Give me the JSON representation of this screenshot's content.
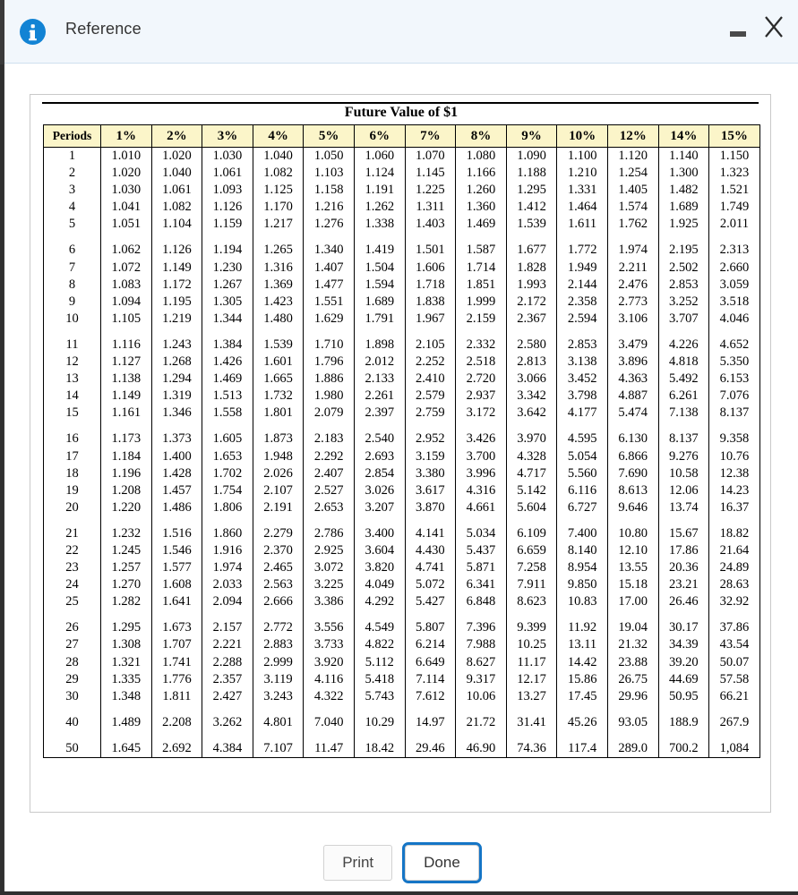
{
  "window": {
    "title": "Reference",
    "info_icon": "info-circle-icon",
    "minimize_label": "Minimize",
    "close_label": "Close",
    "close_glyph": "✕"
  },
  "card": {
    "title": "Future Value of $1"
  },
  "table": {
    "columns": [
      "Periods",
      "1%",
      "2%",
      "3%",
      "4%",
      "5%",
      "6%",
      "7%",
      "8%",
      "9%",
      "10%",
      "12%",
      "14%",
      "15%"
    ],
    "header_background": "#fbf5c9",
    "groups": [
      {
        "rows": [
          [
            "1",
            "1.010",
            "1.020",
            "1.030",
            "1.040",
            "1.050",
            "1.060",
            "1.070",
            "1.080",
            "1.090",
            "1.100",
            "1.120",
            "1.140",
            "1.150"
          ],
          [
            "2",
            "1.020",
            "1.040",
            "1.061",
            "1.082",
            "1.103",
            "1.124",
            "1.145",
            "1.166",
            "1.188",
            "1.210",
            "1.254",
            "1.300",
            "1.323"
          ],
          [
            "3",
            "1.030",
            "1.061",
            "1.093",
            "1.125",
            "1.158",
            "1.191",
            "1.225",
            "1.260",
            "1.295",
            "1.331",
            "1.405",
            "1.482",
            "1.521"
          ],
          [
            "4",
            "1.041",
            "1.082",
            "1.126",
            "1.170",
            "1.216",
            "1.262",
            "1.311",
            "1.360",
            "1.412",
            "1.464",
            "1.574",
            "1.689",
            "1.749"
          ],
          [
            "5",
            "1.051",
            "1.104",
            "1.159",
            "1.217",
            "1.276",
            "1.338",
            "1.403",
            "1.469",
            "1.539",
            "1.611",
            "1.762",
            "1.925",
            "2.011"
          ]
        ]
      },
      {
        "rows": [
          [
            "6",
            "1.062",
            "1.126",
            "1.194",
            "1.265",
            "1.340",
            "1.419",
            "1.501",
            "1.587",
            "1.677",
            "1.772",
            "1.974",
            "2.195",
            "2.313"
          ],
          [
            "7",
            "1.072",
            "1.149",
            "1.230",
            "1.316",
            "1.407",
            "1.504",
            "1.606",
            "1.714",
            "1.828",
            "1.949",
            "2.211",
            "2.502",
            "2.660"
          ],
          [
            "8",
            "1.083",
            "1.172",
            "1.267",
            "1.369",
            "1.477",
            "1.594",
            "1.718",
            "1.851",
            "1.993",
            "2.144",
            "2.476",
            "2.853",
            "3.059"
          ],
          [
            "9",
            "1.094",
            "1.195",
            "1.305",
            "1.423",
            "1.551",
            "1.689",
            "1.838",
            "1.999",
            "2.172",
            "2.358",
            "2.773",
            "3.252",
            "3.518"
          ],
          [
            "10",
            "1.105",
            "1.219",
            "1.344",
            "1.480",
            "1.629",
            "1.791",
            "1.967",
            "2.159",
            "2.367",
            "2.594",
            "3.106",
            "3.707",
            "4.046"
          ]
        ]
      },
      {
        "rows": [
          [
            "11",
            "1.116",
            "1.243",
            "1.384",
            "1.539",
            "1.710",
            "1.898",
            "2.105",
            "2.332",
            "2.580",
            "2.853",
            "3.479",
            "4.226",
            "4.652"
          ],
          [
            "12",
            "1.127",
            "1.268",
            "1.426",
            "1.601",
            "1.796",
            "2.012",
            "2.252",
            "2.518",
            "2.813",
            "3.138",
            "3.896",
            "4.818",
            "5.350"
          ],
          [
            "13",
            "1.138",
            "1.294",
            "1.469",
            "1.665",
            "1.886",
            "2.133",
            "2.410",
            "2.720",
            "3.066",
            "3.452",
            "4.363",
            "5.492",
            "6.153"
          ],
          [
            "14",
            "1.149",
            "1.319",
            "1.513",
            "1.732",
            "1.980",
            "2.261",
            "2.579",
            "2.937",
            "3.342",
            "3.798",
            "4.887",
            "6.261",
            "7.076"
          ],
          [
            "15",
            "1.161",
            "1.346",
            "1.558",
            "1.801",
            "2.079",
            "2.397",
            "2.759",
            "3.172",
            "3.642",
            "4.177",
            "5.474",
            "7.138",
            "8.137"
          ]
        ]
      },
      {
        "rows": [
          [
            "16",
            "1.173",
            "1.373",
            "1.605",
            "1.873",
            "2.183",
            "2.540",
            "2.952",
            "3.426",
            "3.970",
            "4.595",
            "6.130",
            "8.137",
            "9.358"
          ],
          [
            "17",
            "1.184",
            "1.400",
            "1.653",
            "1.948",
            "2.292",
            "2.693",
            "3.159",
            "3.700",
            "4.328",
            "5.054",
            "6.866",
            "9.276",
            "10.76"
          ],
          [
            "18",
            "1.196",
            "1.428",
            "1.702",
            "2.026",
            "2.407",
            "2.854",
            "3.380",
            "3.996",
            "4.717",
            "5.560",
            "7.690",
            "10.58",
            "12.38"
          ],
          [
            "19",
            "1.208",
            "1.457",
            "1.754",
            "2.107",
            "2.527",
            "3.026",
            "3.617",
            "4.316",
            "5.142",
            "6.116",
            "8.613",
            "12.06",
            "14.23"
          ],
          [
            "20",
            "1.220",
            "1.486",
            "1.806",
            "2.191",
            "2.653",
            "3.207",
            "3.870",
            "4.661",
            "5.604",
            "6.727",
            "9.646",
            "13.74",
            "16.37"
          ]
        ]
      },
      {
        "rows": [
          [
            "21",
            "1.232",
            "1.516",
            "1.860",
            "2.279",
            "2.786",
            "3.400",
            "4.141",
            "5.034",
            "6.109",
            "7.400",
            "10.80",
            "15.67",
            "18.82"
          ],
          [
            "22",
            "1.245",
            "1.546",
            "1.916",
            "2.370",
            "2.925",
            "3.604",
            "4.430",
            "5.437",
            "6.659",
            "8.140",
            "12.10",
            "17.86",
            "21.64"
          ],
          [
            "23",
            "1.257",
            "1.577",
            "1.974",
            "2.465",
            "3.072",
            "3.820",
            "4.741",
            "5.871",
            "7.258",
            "8.954",
            "13.55",
            "20.36",
            "24.89"
          ],
          [
            "24",
            "1.270",
            "1.608",
            "2.033",
            "2.563",
            "3.225",
            "4.049",
            "5.072",
            "6.341",
            "7.911",
            "9.850",
            "15.18",
            "23.21",
            "28.63"
          ],
          [
            "25",
            "1.282",
            "1.641",
            "2.094",
            "2.666",
            "3.386",
            "4.292",
            "5.427",
            "6.848",
            "8.623",
            "10.83",
            "17.00",
            "26.46",
            "32.92"
          ]
        ]
      },
      {
        "rows": [
          [
            "26",
            "1.295",
            "1.673",
            "2.157",
            "2.772",
            "3.556",
            "4.549",
            "5.807",
            "7.396",
            "9.399",
            "11.92",
            "19.04",
            "30.17",
            "37.86"
          ],
          [
            "27",
            "1.308",
            "1.707",
            "2.221",
            "2.883",
            "3.733",
            "4.822",
            "6.214",
            "7.988",
            "10.25",
            "13.11",
            "21.32",
            "34.39",
            "43.54"
          ],
          [
            "28",
            "1.321",
            "1.741",
            "2.288",
            "2.999",
            "3.920",
            "5.112",
            "6.649",
            "8.627",
            "11.17",
            "14.42",
            "23.88",
            "39.20",
            "50.07"
          ],
          [
            "29",
            "1.335",
            "1.776",
            "2.357",
            "3.119",
            "4.116",
            "5.418",
            "7.114",
            "9.317",
            "12.17",
            "15.86",
            "26.75",
            "44.69",
            "57.58"
          ],
          [
            "30",
            "1.348",
            "1.811",
            "2.427",
            "3.243",
            "4.322",
            "5.743",
            "7.612",
            "10.06",
            "13.27",
            "17.45",
            "29.96",
            "50.95",
            "66.21"
          ]
        ]
      },
      {
        "rows": [
          [
            "40",
            "1.489",
            "2.208",
            "3.262",
            "4.801",
            "7.040",
            "10.29",
            "14.97",
            "21.72",
            "31.41",
            "45.26",
            "93.05",
            "188.9",
            "267.9"
          ]
        ]
      },
      {
        "rows": [
          [
            "50",
            "1.645",
            "2.692",
            "4.384",
            "7.107",
            "11.47",
            "18.42",
            "29.46",
            "46.90",
            "74.36",
            "117.4",
            "289.0",
            "700.2",
            "1,084"
          ]
        ]
      }
    ]
  },
  "footer": {
    "print_label": "Print",
    "done_label": "Done"
  }
}
